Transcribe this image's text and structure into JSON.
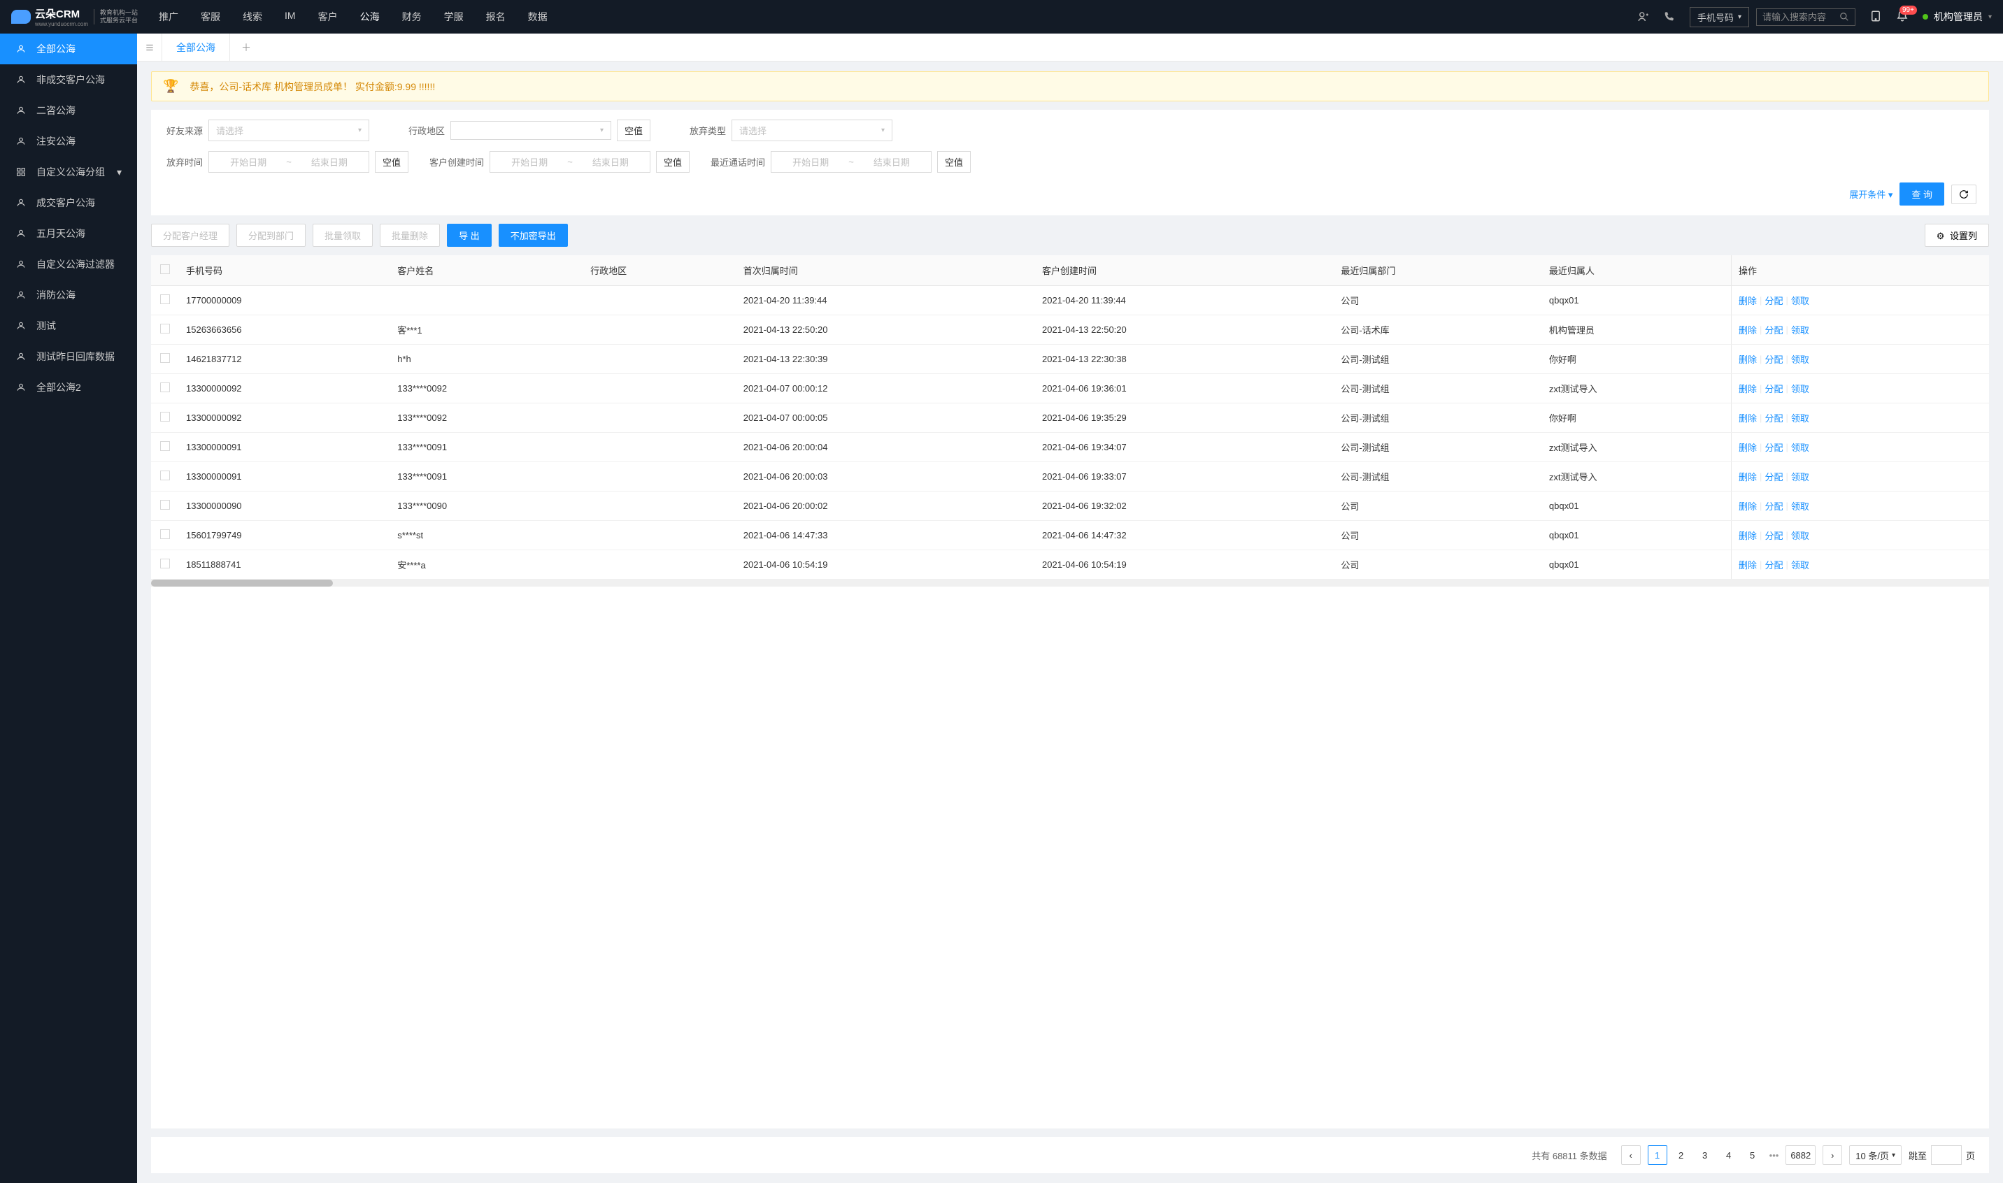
{
  "logo": {
    "name": "云朵CRM",
    "url": "www.yunduocrm.com",
    "tagline1": "教育机构一站",
    "tagline2": "式服务云平台"
  },
  "nav": [
    "推广",
    "客服",
    "线索",
    "IM",
    "客户",
    "公海",
    "财务",
    "学服",
    "报名",
    "数据"
  ],
  "nav_active": 5,
  "header": {
    "search_type": "手机号码",
    "search_placeholder": "请输入搜索内容",
    "badge": "99+",
    "user": "机构管理员"
  },
  "sidebar": [
    "全部公海",
    "非成交客户公海",
    "二咨公海",
    "注安公海",
    "自定义公海分组",
    "成交客户公海",
    "五月天公海",
    "自定义公海过滤器",
    "消防公海",
    "测试",
    "测试昨日回库数据",
    "全部公海2"
  ],
  "sidebar_active": 0,
  "sidebar_has_chevron": 4,
  "tabs": {
    "active": "全部公海"
  },
  "alert": "恭喜，公司-话术库  机构管理员成单！  实付金额:9.99 !!!!!!",
  "filters": {
    "friend_source": "好友来源",
    "admin_region": "行政地区",
    "abandon_type": "放弃类型",
    "abandon_time": "放弃时间",
    "create_time": "客户创建时间",
    "call_time": "最近通话时间",
    "placeholder_select": "请选择",
    "start_date": "开始日期",
    "end_date": "结束日期",
    "null_btn": "空值",
    "expand": "展开条件",
    "query": "查 询"
  },
  "toolbar": {
    "assign_mgr": "分配客户经理",
    "assign_dept": "分配到部门",
    "batch_claim": "批量领取",
    "batch_delete": "批量删除",
    "export": "导 出",
    "export_plain": "不加密导出",
    "set_cols": "设置列"
  },
  "columns": [
    "手机号码",
    "客户姓名",
    "行政地区",
    "首次归属时间",
    "客户创建时间",
    "最近归属部门",
    "最近归属人",
    "操作"
  ],
  "rows": [
    {
      "phone": "17700000009",
      "name": "",
      "region": "",
      "first": "2021-04-20 11:39:44",
      "create": "2021-04-20 11:39:44",
      "dept": "公司",
      "owner": "qbqx01"
    },
    {
      "phone": "15263663656",
      "name": "客***1",
      "region": "",
      "first": "2021-04-13 22:50:20",
      "create": "2021-04-13 22:50:20",
      "dept": "公司-话术库",
      "owner": "机构管理员"
    },
    {
      "phone": "14621837712",
      "name": "h*h",
      "region": "",
      "first": "2021-04-13 22:30:39",
      "create": "2021-04-13 22:30:38",
      "dept": "公司-测试组",
      "owner": "你好啊"
    },
    {
      "phone": "13300000092",
      "name": "133****0092",
      "region": "",
      "first": "2021-04-07 00:00:12",
      "create": "2021-04-06 19:36:01",
      "dept": "公司-测试组",
      "owner": "zxt测试导入"
    },
    {
      "phone": "13300000092",
      "name": "133****0092",
      "region": "",
      "first": "2021-04-07 00:00:05",
      "create": "2021-04-06 19:35:29",
      "dept": "公司-测试组",
      "owner": "你好啊"
    },
    {
      "phone": "13300000091",
      "name": "133****0091",
      "region": "",
      "first": "2021-04-06 20:00:04",
      "create": "2021-04-06 19:34:07",
      "dept": "公司-测试组",
      "owner": "zxt测试导入"
    },
    {
      "phone": "13300000091",
      "name": "133****0091",
      "region": "",
      "first": "2021-04-06 20:00:03",
      "create": "2021-04-06 19:33:07",
      "dept": "公司-测试组",
      "owner": "zxt测试导入"
    },
    {
      "phone": "13300000090",
      "name": "133****0090",
      "region": "",
      "first": "2021-04-06 20:00:02",
      "create": "2021-04-06 19:32:02",
      "dept": "公司",
      "owner": "qbqx01"
    },
    {
      "phone": "15601799749",
      "name": "s****st",
      "region": "",
      "first": "2021-04-06 14:47:33",
      "create": "2021-04-06 14:47:32",
      "dept": "公司",
      "owner": "qbqx01"
    },
    {
      "phone": "18511888741",
      "name": "安****a",
      "region": "",
      "first": "2021-04-06 10:54:19",
      "create": "2021-04-06 10:54:19",
      "dept": "公司",
      "owner": "qbqx01"
    }
  ],
  "row_ops": {
    "delete": "删除",
    "assign": "分配",
    "claim": "领取"
  },
  "pagination": {
    "total_prefix": "共有",
    "total": "68811",
    "total_suffix": "条数据",
    "pages": [
      "1",
      "2",
      "3",
      "4",
      "5"
    ],
    "last": "6882",
    "page_size": "10 条/页",
    "jump_to": "跳至",
    "page_suffix": "页"
  }
}
